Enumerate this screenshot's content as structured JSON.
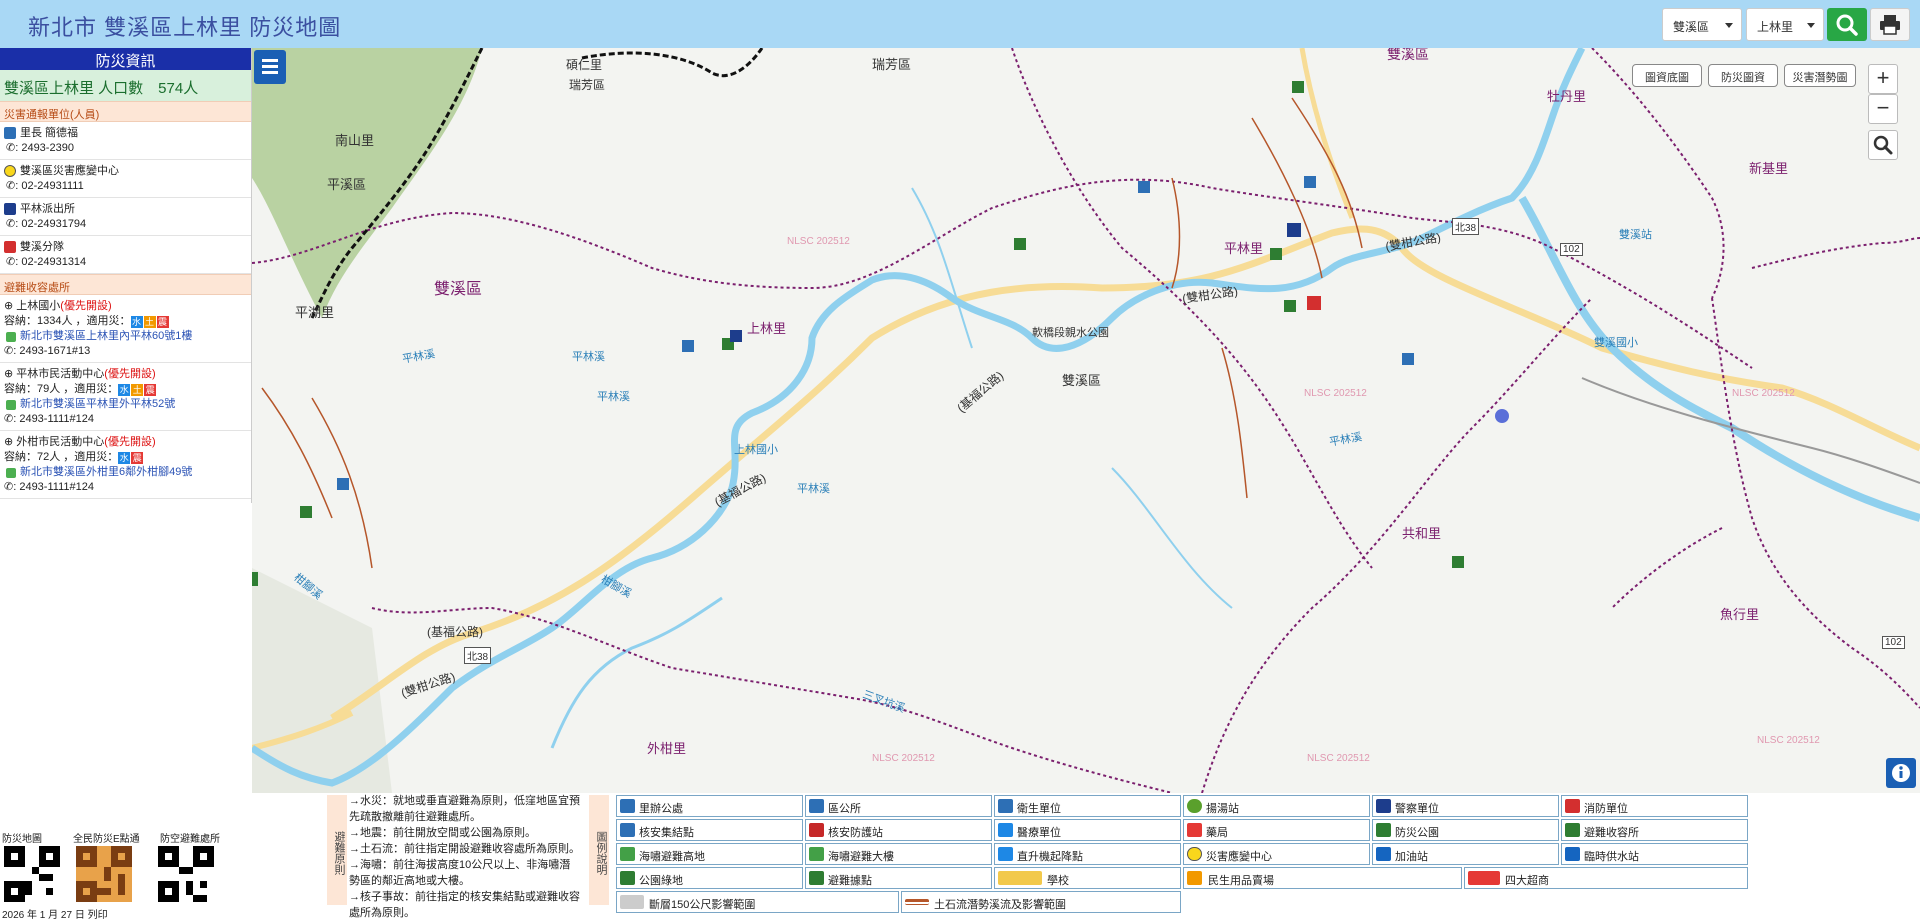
{
  "header": {
    "title": "新北市 雙溪區上林里 防災地圖",
    "district_select": "雙溪區",
    "village_select": "上林里"
  },
  "sidebar": {
    "title": "防災資訊",
    "population": "雙溪區上林里 人口數　574人",
    "contacts_header": "災害通報單位(人員)",
    "contacts": [
      {
        "name": "里長 簡德福",
        "phone": ": 2493-2390"
      },
      {
        "name": "雙溪區災害應變中心",
        "phone": ": 02-24931111"
      },
      {
        "name": "平林派出所",
        "phone": ": 02-24931794"
      },
      {
        "name": "雙溪分隊",
        "phone": ": 02-24931314"
      }
    ],
    "shelters_header": "避難收容處所",
    "priority_label": "(優先開設)",
    "shelters": [
      {
        "name": "上林國小",
        "capacity": "容納：1334人 ，適用災：",
        "address": "新北市雙溪區上林里內平林60號1樓",
        "phone": ": 2493-1671#13"
      },
      {
        "name": "平林市民活動中心",
        "capacity": "容納：79人 ，適用災：",
        "address": "新北市雙溪區平林里外平林52號",
        "phone": ": 2493-1111#124"
      },
      {
        "name": "外柑市民活動中心",
        "capacity": "容納：72人 ，適用災：",
        "address": "新北市雙溪區外柑里6鄰外柑腳49號",
        "phone": ": 2493-1111#124"
      }
    ]
  },
  "map": {
    "buttons": [
      "圖資底圖",
      "防災圖資",
      "災害潛勢圖"
    ],
    "zoom_in": "+",
    "zoom_out": "−",
    "labels": {
      "village_shanglin": "上林里",
      "village_pinglin": "平林里",
      "village_waigan": "外柑里",
      "village_gonghe": "共和里",
      "village_nanshan": "南山里",
      "village_pinghu": "平湖里",
      "village_mudan": "牡丹里",
      "village_xinji": "新基里",
      "village_yuhang": "魚行里",
      "village_shuoren": "碩仁里",
      "dist_shuangxi_1": "雙溪區",
      "dist_shuangxi_2": "雙溪區",
      "dist_shuangxi_3": "雙溪區",
      "dist_pingxi": "平溪區",
      "dist_ruifang_1": "瑞芳區",
      "dist_ruifang_2": "瑞芳區",
      "road_1": "(基福公路)",
      "road_2": "(基福公路)",
      "road_3": "(雙柑公路)",
      "road_4": "(雙柑公路)",
      "road_5": "(雙柑公路)",
      "road_6": "(基福公路)",
      "river_1": "平林溪",
      "river_2": "平林溪",
      "river_3": "平林溪",
      "river_4": "平林溪",
      "river_5": "柑腳溪",
      "river_6": "柑腳溪",
      "river_7": "三叉坑溪",
      "river_8": "平林溪",
      "park": "軟橋段親水公園",
      "school": "上林國小",
      "station_1": "雙溪國小",
      "station_2": "雙溪站",
      "nlsc_1": "NLSC 202512",
      "nlsc_2": "NLSC 202512",
      "nlsc_3": "NLSC 202512",
      "nlsc_4": "NLSC 202512",
      "nlsc_5": "NLSC 202512",
      "nlsc_6": "NLSC 202512",
      "shield_1": "北38",
      "shield_2": "北38",
      "shield_3": "102",
      "shield_4": "102"
    }
  },
  "rules": {
    "tag": "避難原則",
    "items": [
      "→水災：就地或垂直避難為原則，低窪地區宜預先疏散撤離前往避難處所。",
      "→地震：前往開放空間或公園為原則。",
      "→土石流：前往指定開設避難收容處所為原則。",
      "→海嘯：前往海拔高度10公尺以上、非海嘯潛勢區的鄰近高地或大樓。",
      "→核子事故：前往指定的核安集結點或避難收容處所為原則。"
    ]
  },
  "legend": {
    "tag": "圖例說明",
    "items": [
      {
        "label": "里辦公處",
        "color": "#2d6fb5"
      },
      {
        "label": "區公所",
        "color": "#2d6fb5"
      },
      {
        "label": "衛生單位",
        "color": "#2d6fb5"
      },
      {
        "label": "揚湯站",
        "color": "#5aa02c"
      },
      {
        "label": "警察單位",
        "color": "#1d3d8c"
      },
      {
        "label": "消防單位",
        "color": "#d32f2f"
      },
      {
        "label": "核安集結點",
        "color": "#2d6fb5"
      },
      {
        "label": "核安防護站",
        "color": "#c62828"
      },
      {
        "label": "醫療單位",
        "color": "#1e88e5"
      },
      {
        "label": "藥局",
        "color": "#e53935"
      },
      {
        "label": "防災公園",
        "color": "#2e7d32"
      },
      {
        "label": "避難收容所",
        "color": "#2e7d32"
      },
      {
        "label": "海嘯避難高地",
        "color": "#43a047"
      },
      {
        "label": "海嘯避難大樓",
        "color": "#43a047"
      },
      {
        "label": "直升機起降點",
        "color": "#1e88e5"
      },
      {
        "label": "災害應變中心",
        "color": "#f9d71c"
      },
      {
        "label": "加油站",
        "color": "#1565c0"
      },
      {
        "label": "臨時供水站",
        "color": "#1565c0"
      },
      {
        "label": "公園綠地",
        "color": "#2e7d32"
      },
      {
        "label": "避難據點",
        "color": "#2e7d32"
      },
      {
        "label": "學校",
        "color": "#f2c94c"
      },
      {
        "label": "民生用品賣場",
        "color": "#f29900"
      },
      {
        "label": "四大超商",
        "color": "#e53935"
      },
      {
        "label": "斷層150公尺影響範圍",
        "color": "#cccccc"
      },
      {
        "label": "土石流潛勢溪流及影響範圍",
        "color": "#b5562a"
      }
    ]
  },
  "qr": {
    "labels": [
      "防災地圖",
      "全民防災E點通",
      "防空避難處所"
    ],
    "date": "2026 年 1 月 27 日 列印"
  }
}
